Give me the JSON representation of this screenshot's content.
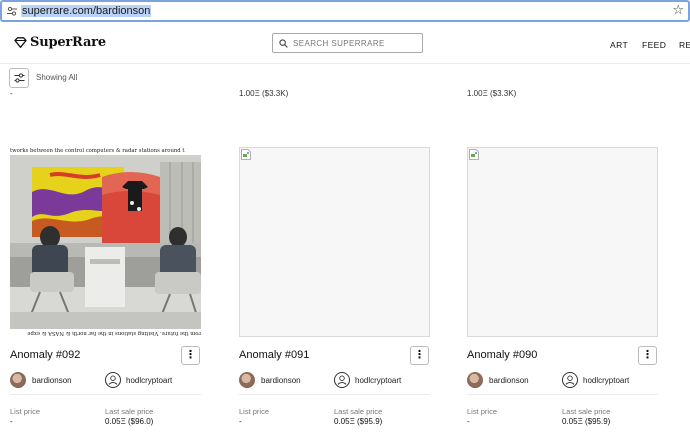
{
  "browser": {
    "url": "superrare.com/bardionson"
  },
  "header": {
    "logo_text": "SuperRare",
    "search_placeholder": "SEARCH SUPERRARE",
    "nav": [
      "ART",
      "FEED",
      "REL"
    ]
  },
  "filter": {
    "showing_label": "Showing All"
  },
  "previous_row": {
    "values": [
      "-",
      "1.00Ξ ($3.3K)",
      "1.00Ξ ($3.3K)"
    ]
  },
  "colors": {
    "accent_border": "#7aa3e0",
    "url_highlight": "#b9d2f5"
  },
  "cards": [
    {
      "title": "Anomaly #092",
      "artwork_caption_top": "tworks between the control computers & radar stations around t",
      "artwork_caption_bottom": "rom the future. Visiting stations in the far north & NASA & expe",
      "artist": "bardionson",
      "owner": "hodlcryptoart",
      "list_price_label": "List price",
      "list_price": "-",
      "last_sale_label": "Last sale price",
      "last_sale": "0.05Ξ ($96.0)"
    },
    {
      "title": "Anomaly #091",
      "artist": "bardionson",
      "owner": "hodlcryptoart",
      "list_price_label": "List price",
      "list_price": "-",
      "last_sale_label": "Last sale price",
      "last_sale": "0.05Ξ ($95.9)"
    },
    {
      "title": "Anomaly #090",
      "artist": "bardionson",
      "owner": "hodlcryptoart",
      "list_price_label": "List price",
      "list_price": "-",
      "last_sale_label": "Last sale price",
      "last_sale": "0.05Ξ ($95.9)"
    }
  ]
}
